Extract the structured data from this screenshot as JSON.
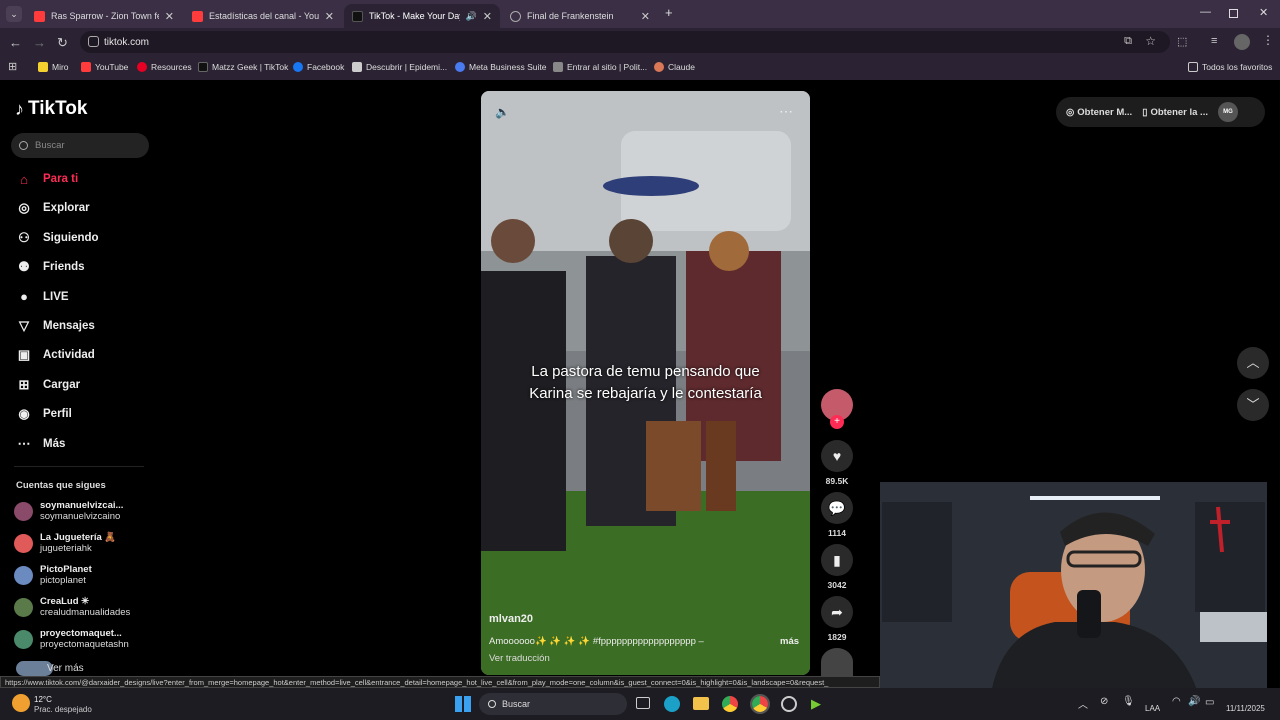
{
  "browser": {
    "tabs": [
      {
        "title": "Ras Sparrow - Zion Town feat. (",
        "color": "#ff3b3b"
      },
      {
        "title": "Estadísticas del canal - YouTube",
        "color": "#ff3b3b"
      },
      {
        "title": "TikTok - Make Your Day",
        "color": "#111111"
      },
      {
        "title": "Final de Frankenstein",
        "color": "#aaaaaa"
      }
    ],
    "url": "tiktok.com",
    "bookmarks": [
      "Miro",
      "YouTube",
      "Resources",
      "Matzz Geek | TikTok",
      "Facebook",
      "Descubrir | Epidemi...",
      "Meta Business Suite",
      "Entrar al sitio | Polit...",
      "Claude"
    ],
    "all_bookmarks": "Todos los favoritos"
  },
  "tiktok": {
    "logo": "TikTok",
    "search_placeholder": "Buscar",
    "nav": [
      {
        "label": "Para ti",
        "icon": "home-icon",
        "active": true
      },
      {
        "label": "Explorar",
        "icon": "compass-icon"
      },
      {
        "label": "Siguiendo",
        "icon": "following-icon"
      },
      {
        "label": "Friends",
        "icon": "friends-icon"
      },
      {
        "label": "LIVE",
        "icon": "live-icon"
      },
      {
        "label": "Mensajes",
        "icon": "messages-icon"
      },
      {
        "label": "Actividad",
        "icon": "activity-icon"
      },
      {
        "label": "Cargar",
        "icon": "upload-icon"
      },
      {
        "label": "Perfil",
        "icon": "profile-icon"
      },
      {
        "label": "Más",
        "icon": "more-icon"
      }
    ],
    "following_header": "Cuentas que sigues",
    "following": [
      {
        "name": "soymanuelvizcai...",
        "user": "soymanuelvizcaino",
        "color": "#8a4a6a"
      },
      {
        "name": "La Juguetería 🧸",
        "user": "jugueteriahk",
        "color": "#e05a5a"
      },
      {
        "name": "PictoPlanet",
        "user": "pictoplanet",
        "color": "#6a8ac0"
      },
      {
        "name": "CreaLud ✳",
        "user": "crealudmanualidades",
        "color": "#5a7a4a"
      },
      {
        "name": "proyectomaquet...",
        "user": "proyectomaquetashn",
        "color": "#4a8a6a"
      }
    ],
    "see_more": "Ver más",
    "top_buttons": [
      "Obtener M...",
      "Obtener la ..."
    ],
    "video": {
      "caption_line1": "La pastora de temu pensando que",
      "caption_line2": "Karina se rebajaría y le contestaría",
      "author": "mlvan20",
      "description": "Amoooooo✨ ✨ ✨ ✨ #fpppppppppppppppppp –",
      "more": "más",
      "translate": "Ver traducción"
    },
    "actions": [
      {
        "icon": "heart-icon",
        "count": "89.5K"
      },
      {
        "icon": "comment-icon",
        "count": "1114"
      },
      {
        "icon": "bookmark-icon",
        "count": "3042"
      },
      {
        "icon": "share-icon",
        "count": "1829"
      }
    ]
  },
  "status_url": "https://www.tiktok.com/@darxaider_designs/live?enter_from_merge=homepage_hot&enter_method=live_cell&entrance_detail=homepage_hot_live_cell&from_play_mode=one_column&is_guest_connect=0&is_highlight=0&is_landscape=0&request_",
  "taskbar": {
    "weather_temp": "12°C",
    "weather_desc": "Prac. despejado",
    "search": "Buscar",
    "lang": "LAA",
    "time": "",
    "date": "11/11/2025"
  }
}
